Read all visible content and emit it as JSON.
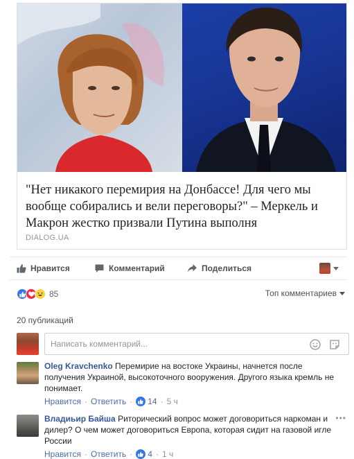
{
  "post": {
    "headline": "\"Нет никакого перемирия на Донбассе! Для чего мы вообще собирались и вели переговоры?\" – Меркель и Макрон жестко призвали Путина выполня",
    "source": "DIALOG.UA"
  },
  "actions": {
    "like": "Нравится",
    "comment": "Комментарий",
    "share": "Поделиться"
  },
  "reactions": {
    "count": "85",
    "top_comments": "Топ комментариев"
  },
  "comments_summary": "20 публикаций",
  "composer": {
    "placeholder": "Написать комментарий..."
  },
  "comments": [
    {
      "author": "Oleg Kravchenko",
      "text": "Перемирие на востоке Украины, начнется после получения Украиной, высокоточного вооружения. Другого языка кремль не понимает.",
      "like_label": "Нравится",
      "reply_label": "Ответить",
      "likes": "14",
      "time": "5 ч"
    },
    {
      "author": "Владиьир Байша",
      "text": "Риторический вопрос может договориться наркоман и дилер? О чем может договориться Европа, которая сидит на газовой игле России",
      "like_label": "Нравится",
      "reply_label": "Ответить",
      "likes": "4",
      "time": "1 ч"
    }
  ],
  "colors": {
    "link_blue": "#365899",
    "like_blue": "#3578e5",
    "love_red": "#f0284a",
    "haha_yellow": "#f7d64a",
    "text_dark": "#1d2129",
    "text_gray": "#90949c"
  }
}
